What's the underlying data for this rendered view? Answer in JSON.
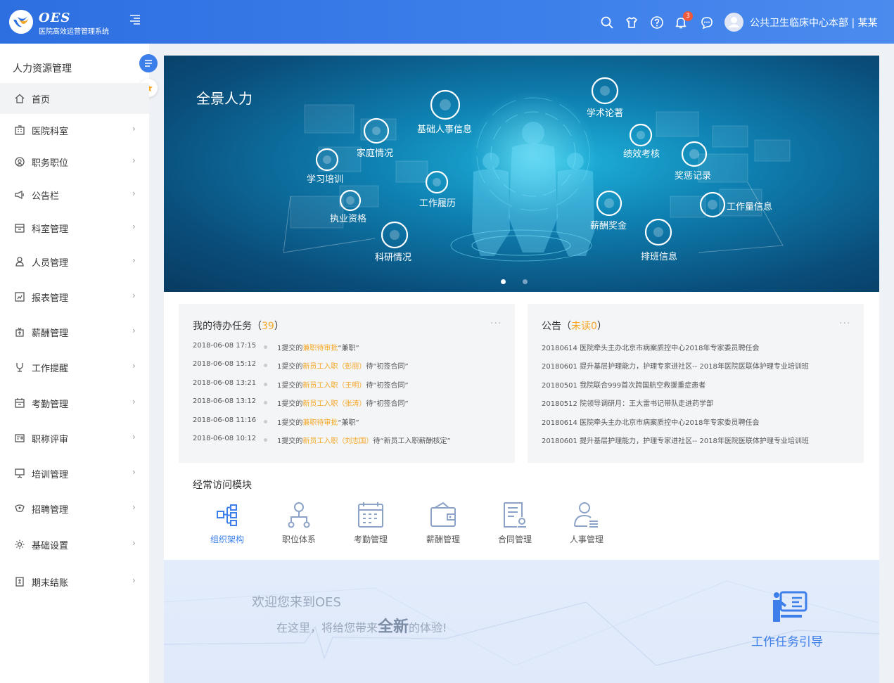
{
  "header": {
    "brand": "OES",
    "subtitle": "医院高效运营管理系统",
    "notification_count": "3",
    "user": "公共卫生临床中心本部 | 某某",
    "icons": [
      "search-icon",
      "shirt-icon",
      "help-icon",
      "bell-icon",
      "chat-icon",
      "avatar-icon"
    ]
  },
  "sidebar": {
    "title": "人力资源管理",
    "items": [
      {
        "label": "首页",
        "icon": "home-icon",
        "active": true
      },
      {
        "label": "医院科室",
        "icon": "building-icon"
      },
      {
        "label": "职务职位",
        "icon": "badge-icon"
      },
      {
        "label": "公告栏",
        "icon": "megaphone-icon"
      },
      {
        "label": "科室管理",
        "icon": "office-icon"
      },
      {
        "label": "人员管理",
        "icon": "person-icon"
      },
      {
        "label": "报表管理",
        "icon": "report-icon"
      },
      {
        "label": "薪酬管理",
        "icon": "salary-icon"
      },
      {
        "label": "工作提醒",
        "icon": "reminder-icon"
      },
      {
        "label": "考勤管理",
        "icon": "calendar-icon"
      },
      {
        "label": "职称评审",
        "icon": "id-card-icon"
      },
      {
        "label": "培训管理",
        "icon": "training-icon"
      },
      {
        "label": "招聘管理",
        "icon": "recruit-icon"
      },
      {
        "label": "基础设置",
        "icon": "settings-icon"
      },
      {
        "label": "期末结账",
        "icon": "ledger-icon"
      }
    ]
  },
  "banner": {
    "title": "全景人力",
    "labels": [
      "基础人事信息",
      "学术论著",
      "家庭情况",
      "绩效考核",
      "学习培训",
      "奖惩记录",
      "工作履历",
      "执业资格",
      "工作量信息",
      "薪酬奖金",
      "科研情况",
      "排班信息"
    ],
    "dots": 2,
    "active_dot": 0
  },
  "tasks": {
    "title": "我的待办任务（",
    "count": "39",
    "title_end": "）",
    "more": "···",
    "rows": [
      {
        "time": "2018-06-08 17:15",
        "pre": "1提交的",
        "link": "兼职待审批",
        "post": "“兼职”"
      },
      {
        "time": "2018-06-08 15:12",
        "pre": "1提交的",
        "link": "新员工入职（彭丽）",
        "post": "待“初签合同”"
      },
      {
        "time": "2018-06-08 13:21",
        "pre": "1提交的",
        "link": "新员工入职（王明）",
        "post": "待“初签合同”"
      },
      {
        "time": "2018-06-08 13:12",
        "pre": "1提交的",
        "link": "新员工入职（张涛）",
        "post": "待“初签合同”"
      },
      {
        "time": "2018-06-08 11:16",
        "pre": "1提交的",
        "link": "兼职待审批",
        "post": "“兼职”"
      },
      {
        "time": "2018-06-08 10:12",
        "pre": "1提交的",
        "link": "新员工入职（刘志国）",
        "post": "待“新员工入职薪酬核定”"
      }
    ]
  },
  "notices": {
    "title": "公告（",
    "unread": "未读0",
    "title_end": "）",
    "more": "···",
    "rows": [
      "20180614 医院牵头主办北京市病案质控中心2018年专家委员聘任会",
      "20180601 提升基层护理能力，护理专家进社区-- 2018年医院医联体护理专业培训班",
      "20180501 我院联合999首次跨国航空救援重症患者",
      "20180512 院领导调研月：王大雷书记带队走进药学部",
      "20180614 医院牵头主办北京市病案质控中心2018年专家委员聘任会",
      "20180601 提升基层护理能力，护理专家进社区-- 2018年医院医联体护理专业培训班"
    ]
  },
  "frequent": {
    "title": "经常访问模块",
    "modules": [
      {
        "label": "组织架构",
        "icon": "org-chart-icon",
        "active": true
      },
      {
        "label": "职位体系",
        "icon": "position-icon"
      },
      {
        "label": "考勤管理",
        "icon": "attendance-icon"
      },
      {
        "label": "薪酬管理",
        "icon": "wallet-icon"
      },
      {
        "label": "合同管理",
        "icon": "contract-icon"
      },
      {
        "label": "人事管理",
        "icon": "hr-icon"
      }
    ]
  },
  "welcome": {
    "line1": "欢迎您来到OES",
    "line2_pre": "在这里，将给您带来",
    "line2_em": "全新",
    "line2_post": "的体验!",
    "guide": "工作任务引导"
  },
  "colors": {
    "primary": "#3d7fea",
    "accent": "#f5a623",
    "badge": "#f05a3a"
  }
}
